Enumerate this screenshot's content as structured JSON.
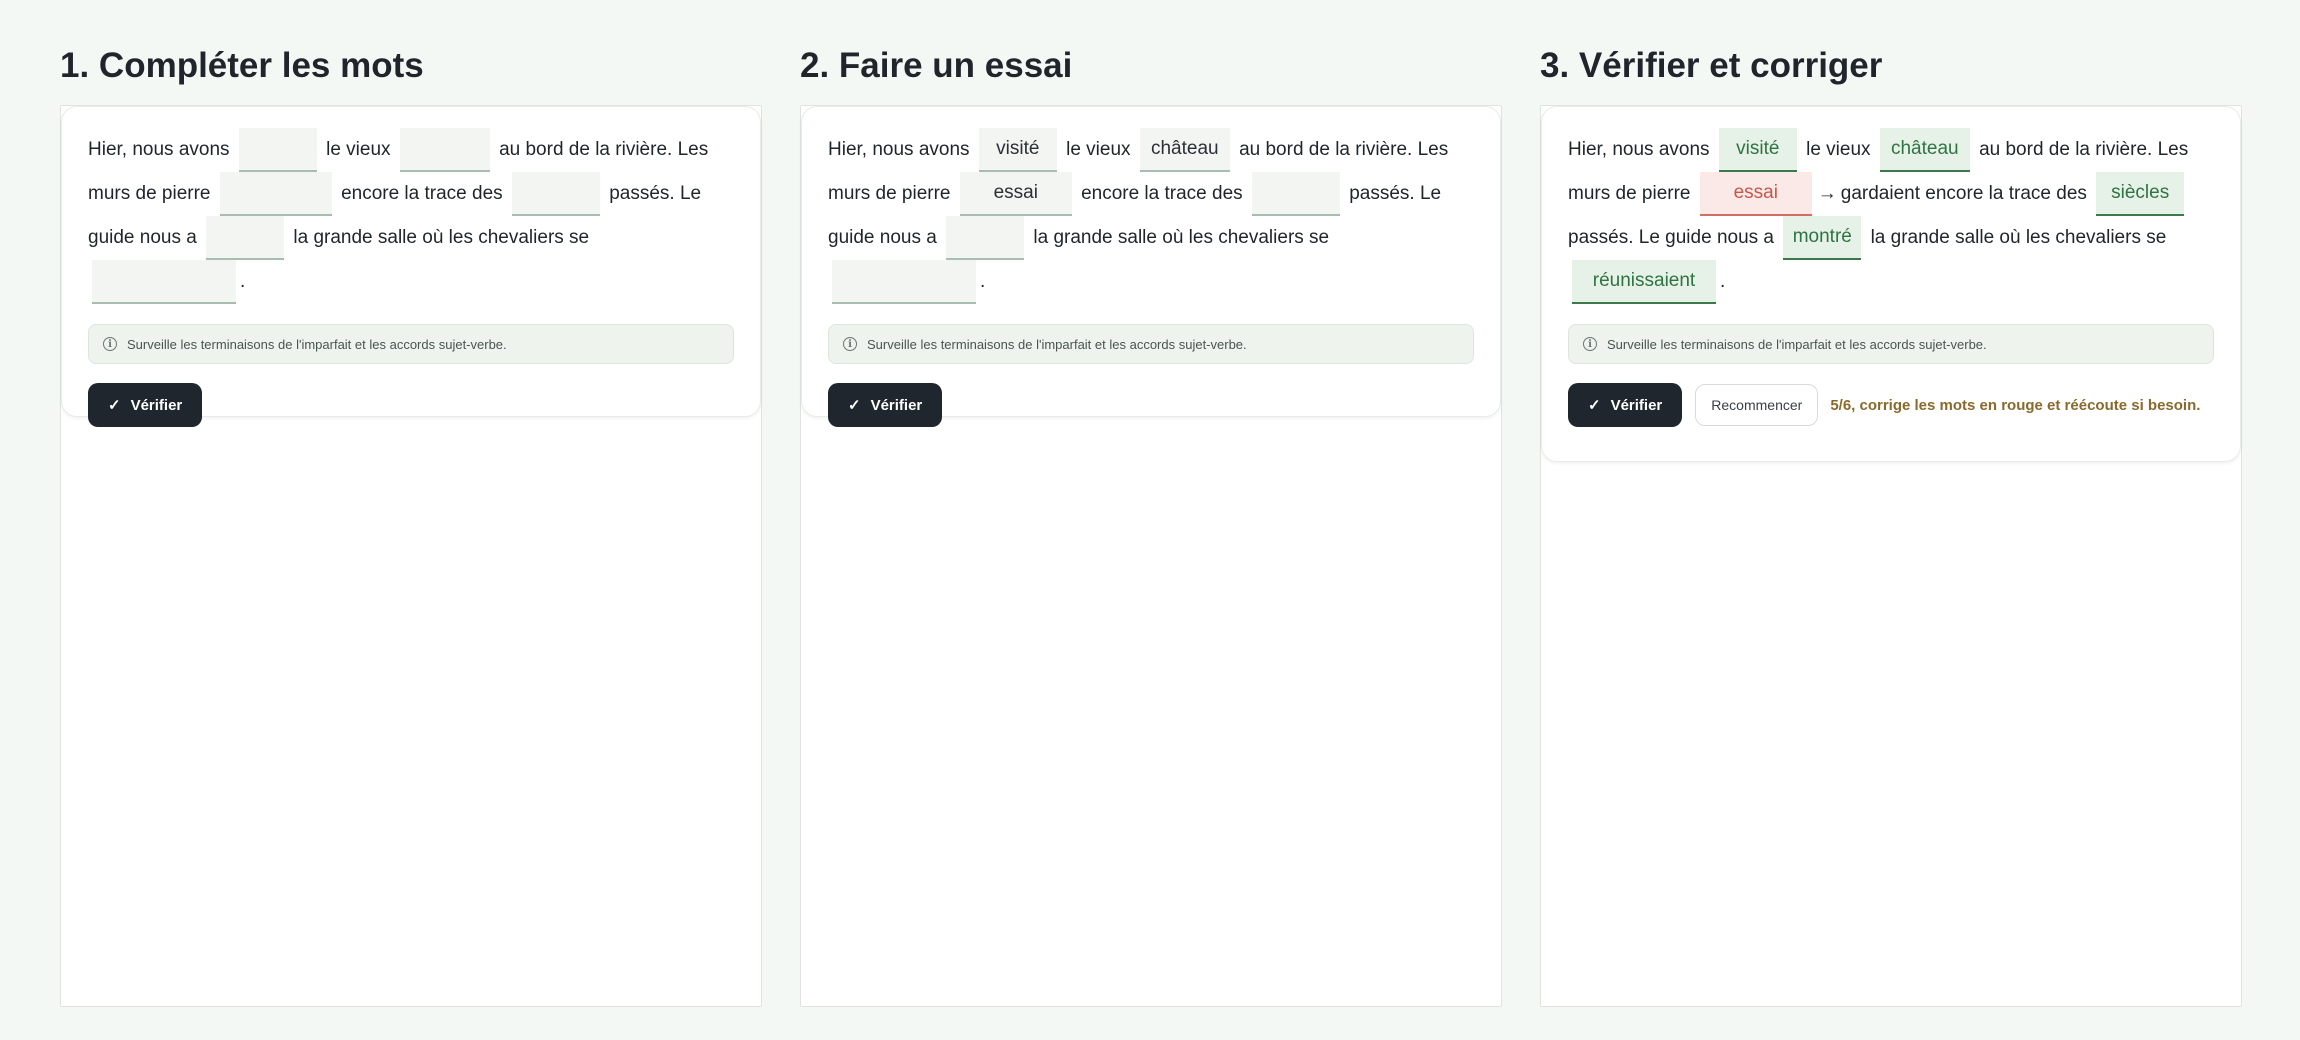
{
  "panels": [
    {
      "title": "1. Compléter les mots",
      "sentence": {
        "t1": "Hier, nous avons",
        "t2": "le vieux",
        "t3": "au bord de la rivière. Les",
        "t4": "murs de pierre",
        "t5": "encore la trace des",
        "t6": "passés. Le",
        "t7": "guide nous a",
        "t8": "la grande salle où les chevaliers se",
        "t9": "."
      },
      "blanks": [
        "",
        "",
        "",
        "",
        "",
        ""
      ],
      "hint": "Surveille les terminaisons de l'imparfait et les accords sujet-verbe.",
      "verify_label": "Vérifier"
    },
    {
      "title": "2. Faire un essai",
      "sentence": {
        "t1": "Hier, nous avons",
        "t2": "le vieux",
        "t3": "au bord de la rivière. Les",
        "t4": "murs de pierre",
        "t5": "encore la trace des",
        "t6": "passés. Le",
        "t7": "guide nous a",
        "t8": "la grande salle où les chevaliers se",
        "t9": "."
      },
      "blanks": [
        "visité",
        "château",
        "essai",
        "",
        "",
        ""
      ],
      "hint": "Surveille les terminaisons de l'imparfait et les accords sujet-verbe.",
      "verify_label": "Vérifier"
    },
    {
      "title": "3. Vérifier et corriger",
      "sentence": {
        "t1": "Hier, nous avons",
        "t2": "le vieux",
        "t3": "au bord de la rivière. Les",
        "t4": "murs de pierre",
        "t5": "gardaient encore la trace des",
        "t6": "passés. Le guide nous a",
        "t7": "la grande salle où les chevaliers se",
        "t8": "."
      },
      "blanks": [
        "visité",
        "château",
        "essai",
        "siècles",
        "montré",
        "réunissaient"
      ],
      "correction_arrow": "→",
      "hint": "Surveille les terminaisons de l'imparfait et les accords sujet-verbe.",
      "verify_label": "Vérifier",
      "restart_label": "Recommencer",
      "feedback": "5/6, corrige les mots en rouge et réécoute si besoin."
    }
  ],
  "colors": {
    "correct": "#2f7344",
    "incorrect": "#c4584b",
    "feedback": "#8a6a2c",
    "button": "#1f262d"
  },
  "icons": [
    "info-icon",
    "check-icon"
  ]
}
